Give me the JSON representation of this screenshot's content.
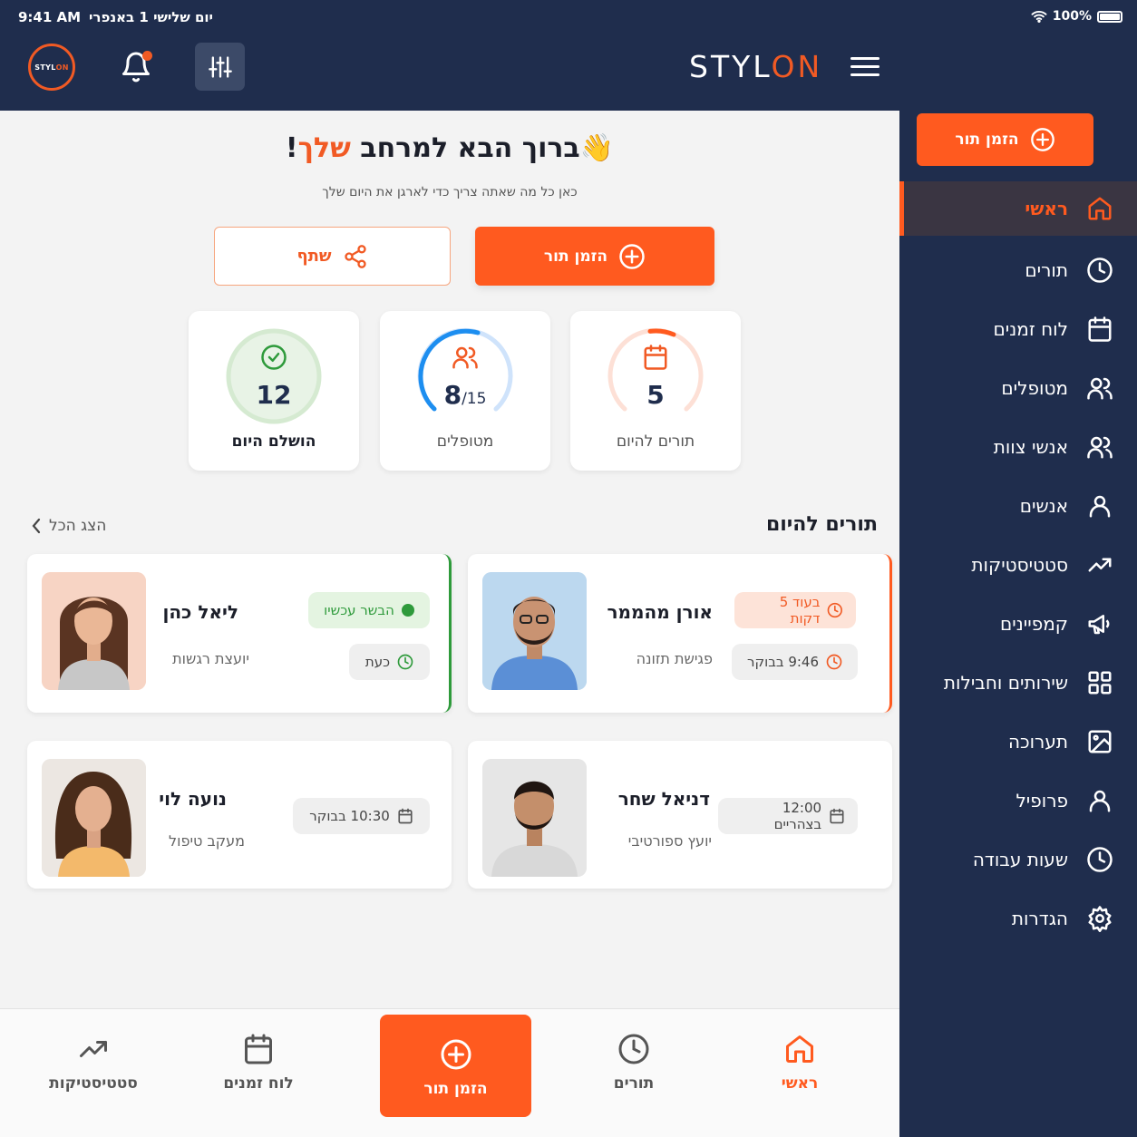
{
  "status": {
    "time": "9:41 AM",
    "date": "יום שלישי 1 באנפרי",
    "battery": "100%"
  },
  "header": {
    "brand_a": "STYL",
    "brand_b": "ON",
    "logo_a": "STYL",
    "logo_b": "ON"
  },
  "sidebar": {
    "cta": "הזמן תור",
    "items": [
      {
        "label": "ראשי",
        "icon": "home-icon"
      },
      {
        "label": "תורים",
        "icon": "clock-icon"
      },
      {
        "label": "לוח זמנים",
        "icon": "calendar-icon"
      },
      {
        "label": "מטופלים",
        "icon": "users-icon"
      },
      {
        "label": "אנשי צוות",
        "icon": "team-icon"
      },
      {
        "label": "אנשים",
        "icon": "person-icon"
      },
      {
        "label": "סטטיסטיקות",
        "icon": "trend-icon"
      },
      {
        "label": "קמפיינים",
        "icon": "megaphone-icon"
      },
      {
        "label": "שירותים וחבילות",
        "icon": "grid-icon"
      },
      {
        "label": "תערוכה",
        "icon": "image-icon"
      },
      {
        "label": "פרופיל",
        "icon": "profile-icon"
      },
      {
        "label": "שעות עבודה",
        "icon": "clock-icon"
      },
      {
        "label": "הגדרות",
        "icon": "gear-icon"
      }
    ]
  },
  "welcome": {
    "title_a": "ברוך הבא למרחב ",
    "title_accent": "שלך",
    "title_end": "!",
    "emoji": "👋",
    "subtitle": "כאן כל מה שאתה צריך כדי לארגן את היום שלך"
  },
  "actions": {
    "book": "הזמן תור",
    "share": "שתף"
  },
  "stats": [
    {
      "value": "5",
      "label": "תורים להיום"
    },
    {
      "value": "8",
      "total": "/15",
      "label": "מטופלים"
    },
    {
      "value": "12",
      "label": "הושלם היום"
    }
  ],
  "today": {
    "title": "תורים להיום",
    "show_all": "הצג הכל",
    "appointments": [
      {
        "name": "אורן מהממר",
        "role": "פגישת תזונה",
        "status": "בעוד 5 דקות",
        "time": "9:46 בבוקר"
      },
      {
        "name": "ליאל כהן",
        "role": "יועצת רגשות",
        "status": "הבשר עכשיו",
        "time": "כעת"
      },
      {
        "name": "דניאל שחר",
        "role": "יועץ ספורטיבי",
        "time": "12:00 בצהריים"
      },
      {
        "name": "נועה לוי",
        "role": "מעקב טיפול",
        "time": "10:30 בבוקר"
      }
    ]
  },
  "tabbar": {
    "home": "ראשי",
    "appointments": "תורים",
    "book": "הזמן תור",
    "schedule": "לוח זמנים",
    "stats": "סטטיסטיקות"
  },
  "colors": {
    "navy": "#1f2d4d",
    "accent": "#ff5a1f",
    "success": "#2e9a3b"
  }
}
